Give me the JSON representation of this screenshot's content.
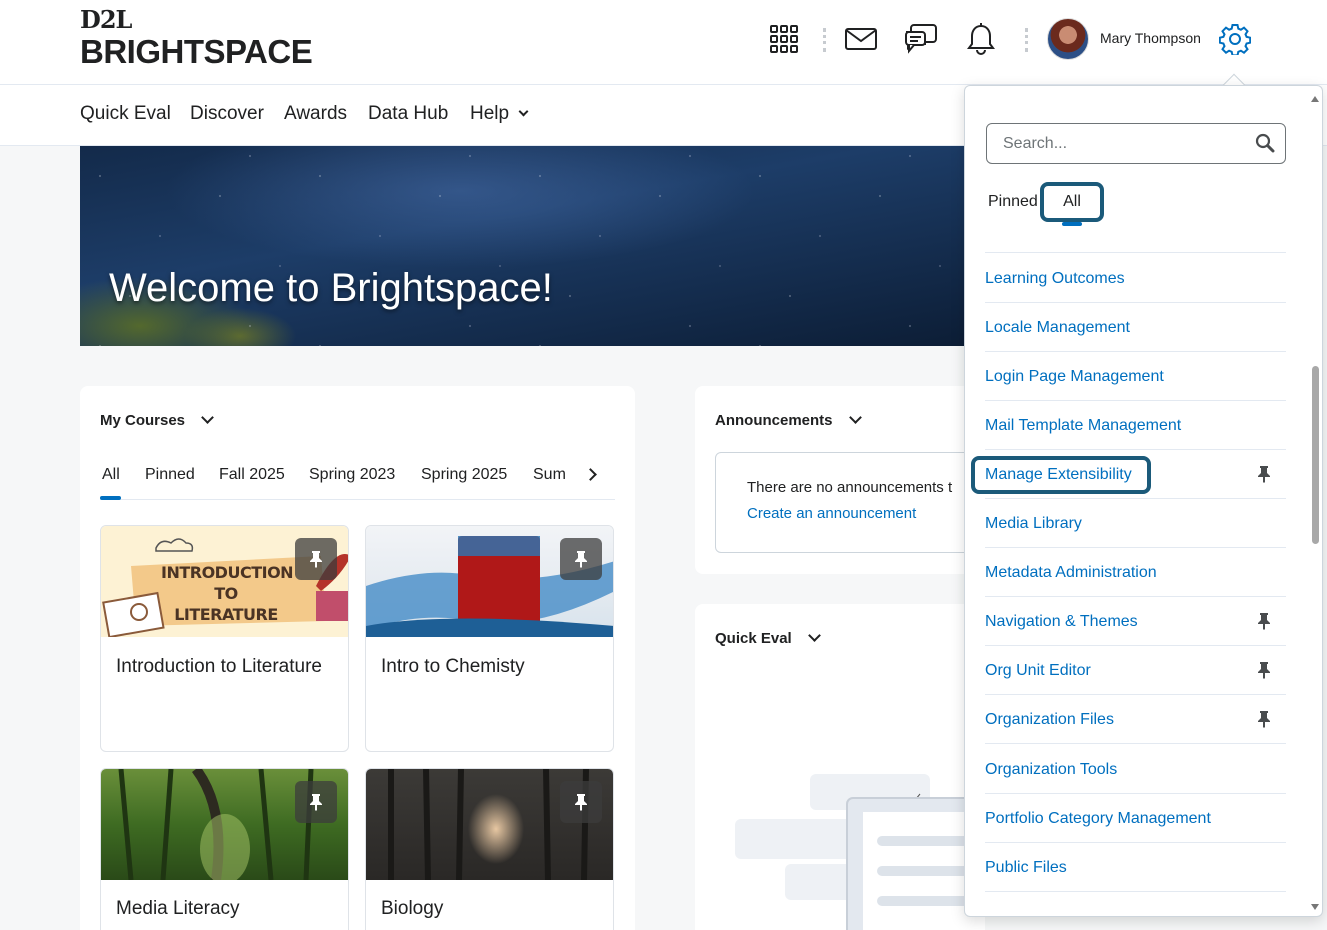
{
  "header": {
    "logo_top": "D2L",
    "logo_bottom": "BRIGHTSPACE",
    "user_name": "Mary Thompson",
    "icons": [
      "apps-grid-icon",
      "mail-icon",
      "chat-icon",
      "bell-icon",
      "gear-icon"
    ]
  },
  "nav": {
    "items": [
      "Quick Eval",
      "Discover",
      "Awards",
      "Data Hub",
      "Help"
    ]
  },
  "banner": {
    "title": "Welcome to Brightspace!"
  },
  "my_courses": {
    "title": "My Courses",
    "tabs": [
      "All",
      "Pinned",
      "Fall 2025",
      "Spring 2023",
      "Spring 2025",
      "Sum"
    ],
    "selected_tab": "All",
    "cards": [
      {
        "title": "Introduction to Literature",
        "image_text": "INTRODUCTION TO LITERATURE",
        "pinned": true
      },
      {
        "title": "Intro to Chemisty",
        "pinned": true
      },
      {
        "title": "Media Literacy",
        "pinned": true
      },
      {
        "title": "Biology",
        "pinned": true
      }
    ]
  },
  "announcements": {
    "title": "Announcements",
    "empty_text": "There are no announcements t",
    "create_link": "Create an announcement"
  },
  "quick_eval": {
    "title": "Quick Eval"
  },
  "admin_menu": {
    "search_placeholder": "Search...",
    "tab_pinned": "Pinned",
    "tab_all": "All",
    "selected_tab": "All",
    "items": [
      {
        "label": "Learning Outcomes",
        "pinned": false
      },
      {
        "label": "Locale Management",
        "pinned": false
      },
      {
        "label": "Login Page Management",
        "pinned": false
      },
      {
        "label": "Mail Template Management",
        "pinned": false
      },
      {
        "label": "Manage Extensibility",
        "pinned": true,
        "focused": true
      },
      {
        "label": "Media Library",
        "pinned": false
      },
      {
        "label": "Metadata Administration",
        "pinned": false
      },
      {
        "label": "Navigation & Themes",
        "pinned": true
      },
      {
        "label": "Org Unit Editor",
        "pinned": true
      },
      {
        "label": "Organization Files",
        "pinned": true
      },
      {
        "label": "Organization Tools",
        "pinned": false
      },
      {
        "label": "Portfolio Category Management",
        "pinned": false
      },
      {
        "label": "Public Files",
        "pinned": false
      }
    ]
  },
  "colors": {
    "link": "#006fbf",
    "focus_ring": "#1b5a7a",
    "text": "#202122",
    "page_bg": "#f6f7f8"
  }
}
